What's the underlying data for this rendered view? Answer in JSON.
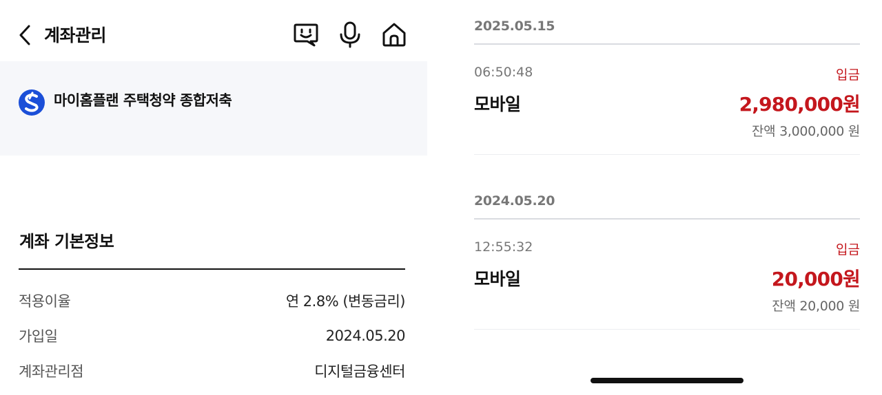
{
  "header": {
    "title": "계좌관리",
    "icons": [
      "back-icon",
      "chatbot-icon",
      "mic-icon",
      "home-icon"
    ]
  },
  "product": {
    "name": "마이홈플랜 주택청약 종합저축",
    "logo": "shinhan-logo-icon",
    "accent_color": "#1b4fd8"
  },
  "basic_info": {
    "title": "계좌 기본정보",
    "rows": [
      {
        "label": "적용이율",
        "value": "연 2.8% (변동금리)"
      },
      {
        "label": "가입일",
        "value": "2024.05.20"
      },
      {
        "label": "계좌관리점",
        "value": "디지털금융센터"
      }
    ]
  },
  "transactions": [
    {
      "date": "2025.05.15",
      "time": "06:50:48",
      "type": "입금",
      "memo": "모바일",
      "amount": "2,980,000원",
      "balance": "잔액 3,000,000 원"
    },
    {
      "date": "2024.05.20",
      "time": "12:55:32",
      "type": "입금",
      "memo": "모바일",
      "amount": "20,000원",
      "balance": "잔액 20,000 원"
    }
  ],
  "colors": {
    "deposit": "#c4171d",
    "banner_bg": "#f6f7fa",
    "divider": "#d9dbe0"
  }
}
